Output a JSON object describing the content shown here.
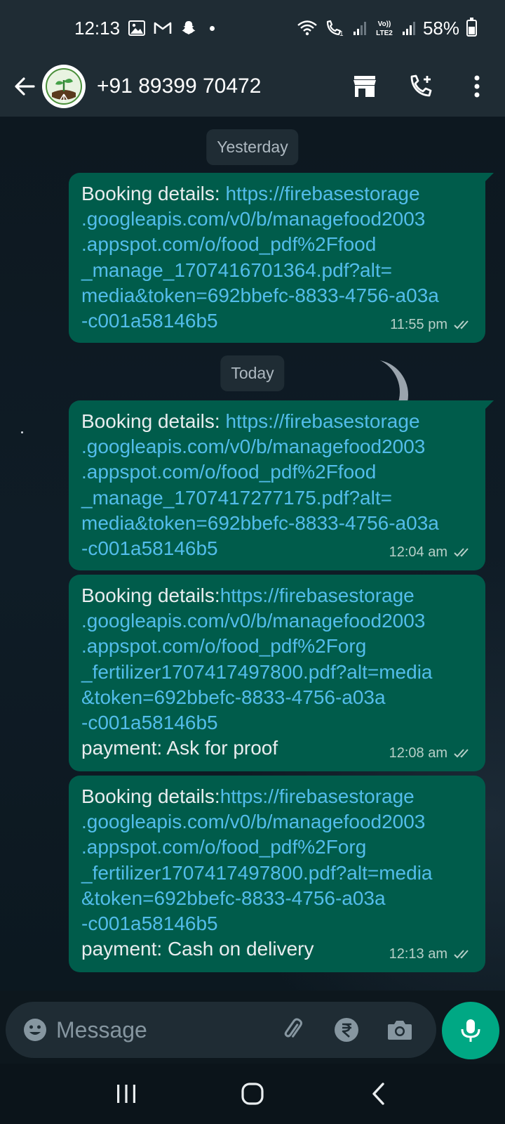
{
  "status_bar": {
    "time": "12:13",
    "volte_label": "Vo)\nLTE2",
    "battery": "58%",
    "icons": [
      "gallery-icon",
      "gmail-icon",
      "snapchat-icon",
      "notification-dot",
      "wifi-icon",
      "wifi-call-icon",
      "signal-icon",
      "volte-icon",
      "signal-icon",
      "battery-icon"
    ]
  },
  "header": {
    "contact": "+91 89399 70472",
    "icons": [
      "back-arrow-icon",
      "avatar",
      "shop-icon",
      "add-call-icon",
      "more-vert-icon"
    ]
  },
  "chat": {
    "dates": [
      "Yesterday",
      "Today"
    ],
    "messages": [
      {
        "lines": [
          {
            "pre": "Booking details: ",
            "link": "https://firebasestorage"
          },
          {
            "link": ".googleapis.com/v0/b/managefood2003"
          },
          {
            "link": ".appspot.com/o/food_pdf%2Ffood"
          },
          {
            "link": "_manage_1707416701364.pdf?alt="
          },
          {
            "link": "media&token=692bbefc-8833-4756-a03a"
          },
          {
            "link": "-c001a58146b5"
          }
        ],
        "time": "11:55 pm",
        "status": "read"
      },
      {
        "lines": [
          {
            "pre": "Booking details: ",
            "link": "https://firebasestorage"
          },
          {
            "link": ".googleapis.com/v0/b/managefood2003"
          },
          {
            "link": ".appspot.com/o/food_pdf%2Ffood"
          },
          {
            "link": "_manage_1707417277175.pdf?alt="
          },
          {
            "link": "media&token=692bbefc-8833-4756-a03a"
          },
          {
            "link": "-c001a58146b5"
          }
        ],
        "time": "12:04 am",
        "status": "read"
      },
      {
        "lines": [
          {
            "pre": "Booking details:",
            "link": "https://firebasestorage"
          },
          {
            "link": ".googleapis.com/v0/b/managefood2003"
          },
          {
            "link": ".appspot.com/o/food_pdf%2Forg"
          },
          {
            "link": "_fertilizer1707417497800.pdf?alt=media"
          },
          {
            "link": "&token=692bbefc-8833-4756-a03a"
          },
          {
            "link": "-c001a58146b5"
          },
          {
            "pre": "payment: Ask for proof"
          }
        ],
        "time": "12:08 am",
        "status": "read"
      },
      {
        "lines": [
          {
            "pre": "Booking details:",
            "link": "https://firebasestorage"
          },
          {
            "link": ".googleapis.com/v0/b/managefood2003"
          },
          {
            "link": ".appspot.com/o/food_pdf%2Forg"
          },
          {
            "link": "_fertilizer1707417497800.pdf?alt=media"
          },
          {
            "link": "&token=692bbefc-8833-4756-a03a"
          },
          {
            "link": "-c001a58146b5"
          },
          {
            "pre": "payment: Cash on delivery"
          }
        ],
        "time": "12:13 am",
        "status": "read"
      }
    ]
  },
  "composer": {
    "placeholder": "Message",
    "icons": [
      "emoji-icon",
      "attach-icon",
      "rupee-icon",
      "camera-icon",
      "mic-icon"
    ]
  },
  "nav": {
    "icons": [
      "recents-icon",
      "home-icon",
      "back-icon"
    ]
  },
  "colors": {
    "header_bg": "#1f2c34",
    "outgoing_bubble": "#005c4b",
    "link": "#53bdeb",
    "accent": "#00a884",
    "read_ticks": "#b7cfc8"
  }
}
